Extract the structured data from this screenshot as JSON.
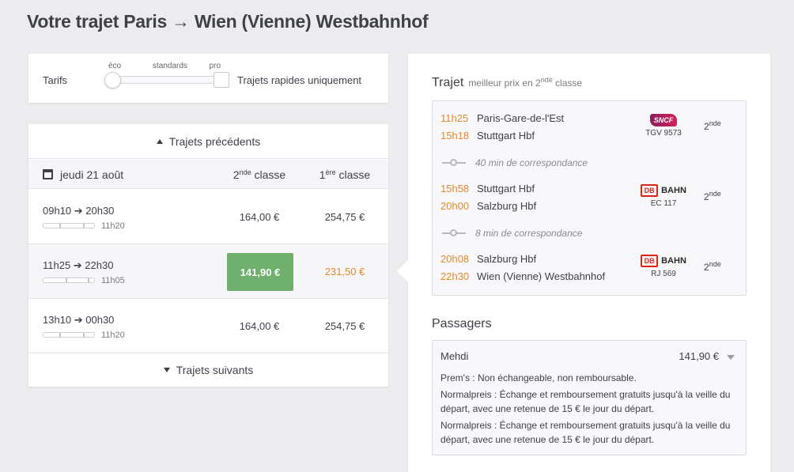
{
  "page": {
    "title": "Votre trajet Paris → Wien (Vienne) Westbahnhof"
  },
  "filters": {
    "tarifs_label": "Tarifs",
    "ticks": {
      "eco": "éco",
      "standard": "standards",
      "pro": "pro"
    },
    "selected": "éco",
    "fast_only_label": "Trajets rapides uniquement",
    "fast_only_checked": false
  },
  "trips": {
    "prev_label": "Trajets précédents",
    "next_label": "Trajets suivants",
    "date": "jeudi 21 août",
    "col2_main": "2",
    "col2_sup": "nde",
    "col2_rest": " classe",
    "col1_main": "1",
    "col1_sup": "ère",
    "col1_rest": " classe",
    "rows": [
      {
        "times": "09h10 ➔ 20h30",
        "duration": "11h20",
        "price2": "164,00 €",
        "price1": "254,75 €"
      },
      {
        "times": "11h25 ➔ 22h30",
        "duration": "11h05",
        "price2": "141,90 €",
        "price1": "231,50 €"
      },
      {
        "times": "13h10 ➔ 00h30",
        "duration": "11h20",
        "price2": "164,00 €",
        "price1": "254,75 €"
      }
    ]
  },
  "detail": {
    "trajet_title": "Trajet",
    "trajet_sub_pre": "meilleur prix en 2",
    "trajet_sub_sup": "nde",
    "trajet_sub_post": " classe",
    "segments": [
      {
        "dep_time": "11h25",
        "dep_station": "Paris-Gare-de-l'Est",
        "arr_time": "15h18",
        "arr_station": "Stuttgart Hbf",
        "operator": "SNCF",
        "train": "TGV 9573",
        "class_main": "2",
        "class_sup": "nde"
      },
      {
        "dep_time": "15h58",
        "dep_station": "Stuttgart Hbf",
        "arr_time": "20h00",
        "arr_station": "Salzburg Hbf",
        "operator_box": "DB",
        "operator": "BAHN",
        "train": "EC 117",
        "class_main": "2",
        "class_sup": "nde"
      },
      {
        "dep_time": "20h08",
        "dep_station": "Salzburg Hbf",
        "arr_time": "22h30",
        "arr_station": "Wien (Vienne) Westbahnhof",
        "operator_box": "DB",
        "operator": "BAHN",
        "train": "RJ 569",
        "class_main": "2",
        "class_sup": "nde"
      }
    ],
    "connections": [
      "40 min de correspondance",
      "8 min de correspondance"
    ],
    "passagers_title": "Passagers",
    "passenger": {
      "name": "Mehdi",
      "price": "141,90 €",
      "conditions": [
        "Prem's : Non échangeable, non remboursable.",
        "Normalpreis : Échange et remboursement gratuits jusqu'à la veille du départ, avec une retenue de 15 € le jour du départ.",
        "Normalpreis : Échange et remboursement gratuits jusqu'à la veille du départ, avec une retenue de 15 € le jour du départ."
      ]
    }
  },
  "colors": {
    "accent_green": "#6fb06f",
    "time_orange": "#e68a2e",
    "sncf": "#b01e5e",
    "db_red": "#e2231a"
  }
}
